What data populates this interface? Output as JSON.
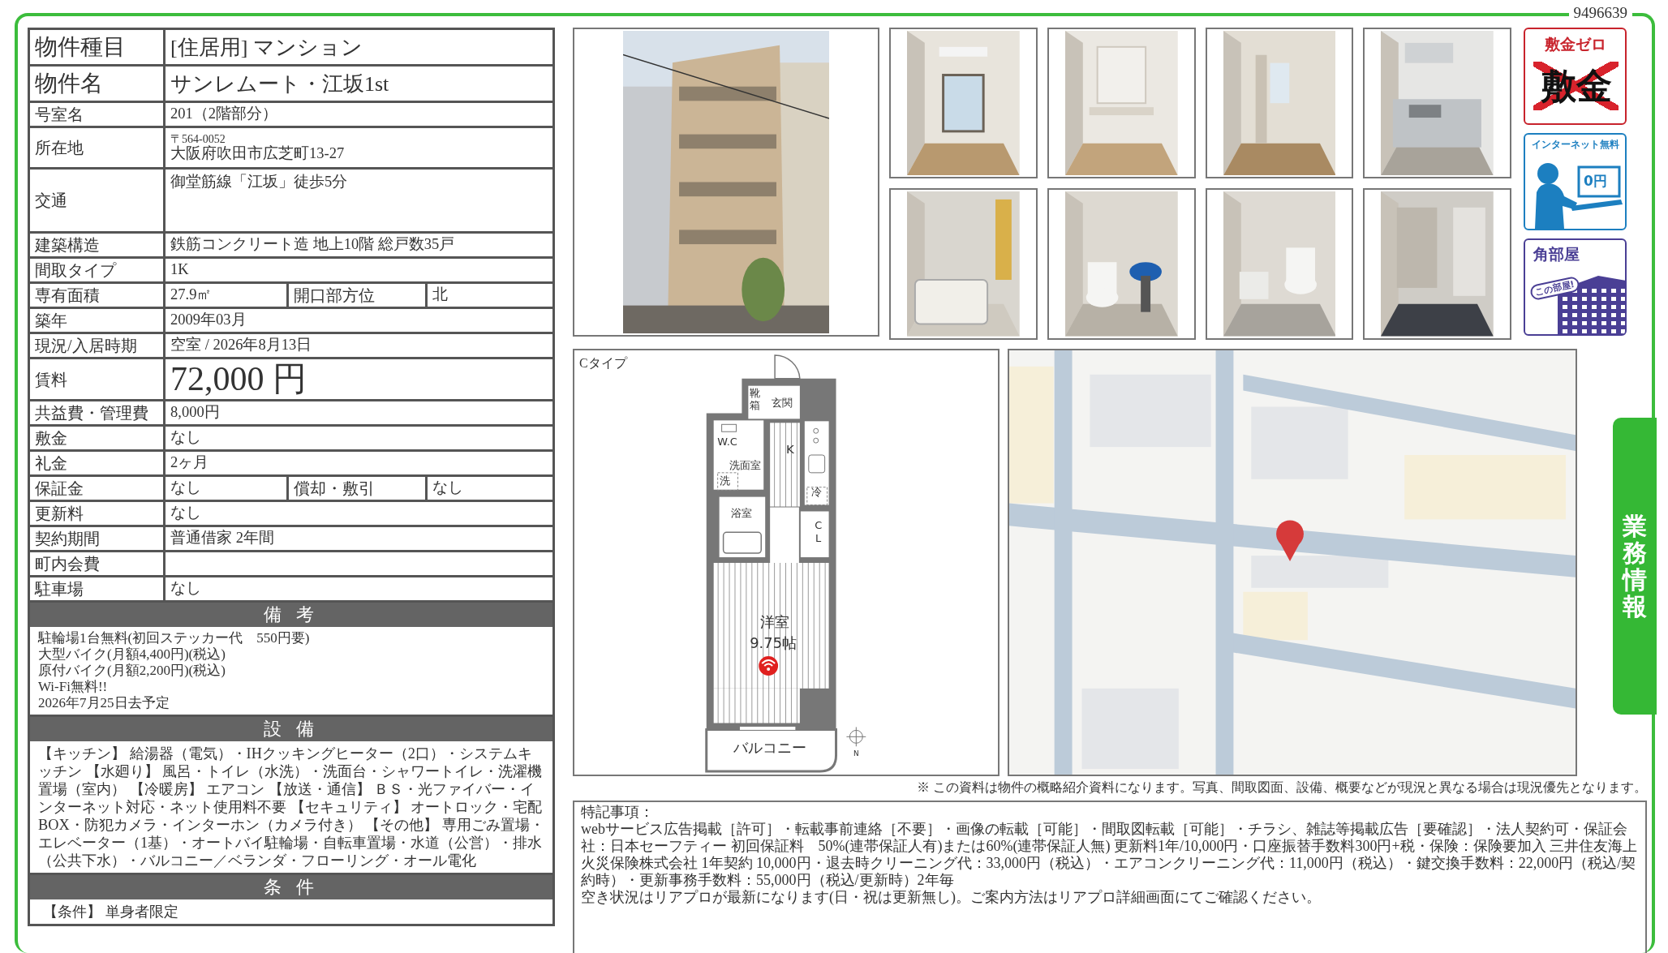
{
  "document_id": "9496639",
  "side_tab": "業務情報",
  "property_table": [
    {
      "kind": "title",
      "label": "物件種目",
      "value": "[住居用] マンション"
    },
    {
      "kind": "title",
      "label": "物件名",
      "value": "サンレムート・江坂1st"
    },
    {
      "kind": "plain",
      "label": "号室名",
      "value": "201（2階部分）"
    },
    {
      "kind": "address",
      "label": "所在地",
      "postal": "〒564-0052",
      "value": "大阪府吹田市広芝町13-27"
    },
    {
      "kind": "tall",
      "label": "交通",
      "value": "御堂筋線「江坂」徒歩5分"
    },
    {
      "kind": "plain",
      "label": "建築構造",
      "value": "鉄筋コンクリート造 地上10階 総戸数35戸"
    },
    {
      "kind": "plain",
      "label": "間取タイプ",
      "value": "1K"
    },
    {
      "kind": "split",
      "label": "専有面積",
      "value": "27.9㎡",
      "label_2": "開口部方位",
      "value_2": "北"
    },
    {
      "kind": "plain",
      "label": "築年",
      "value": "2009年03月"
    },
    {
      "kind": "plain",
      "label": "現況/入居時期",
      "value": "空室 / 2026年8月13日"
    },
    {
      "kind": "rent",
      "label": "賃料",
      "value": "72,000 円"
    },
    {
      "kind": "plain",
      "label": "共益費・管理費",
      "value": "8,000円"
    },
    {
      "kind": "plain",
      "label": "敷金",
      "value": "なし"
    },
    {
      "kind": "plain",
      "label": "礼金",
      "value": "2ヶ月"
    },
    {
      "kind": "split",
      "label": "保証金",
      "value": "なし",
      "label_2": "償却・敷引",
      "value_2": "なし"
    },
    {
      "kind": "plain",
      "label": "更新料",
      "value": "なし"
    },
    {
      "kind": "plain",
      "label": "契約期間",
      "value": "普通借家 2年間"
    },
    {
      "kind": "plain",
      "label": "町内会費"
    },
    {
      "kind": "plain",
      "label": "駐車場",
      "value": "なし"
    }
  ],
  "remarks": {
    "heading": "備 考",
    "lines": [
      "駐輪場1台無料(初回ステッカー代　550円要)",
      "大型バイク(月額4,400円)(税込)",
      "原付バイク(月額2,200円)(税込)",
      "Wi-Fi無料!!",
      "2026年7月25日去予定"
    ]
  },
  "equipment": {
    "heading": "設 備",
    "text": "【キッチン】 給湯器（電気）・IHクッキングヒーター（2口）・システムキッチン 【水廻り】 風呂・トイレ（水洗）・洗面台・シャワートイレ・洗濯機置場（室内） 【冷暖房】 エアコン 【放送・通信】 ＢＳ・光ファイバー・インターネット対応・ネット使用料不要 【セキュリティ】 オートロック・宅配BOX・防犯カメラ・インターホン（カメラ付き） 【その他】 専用ごみ置場・エレベーター（1基）・オートバイ駐輪場・自転車置場・水道（公営）・排水（公共下水）・バルコニー／ベランダ・フローリング・オール電化"
  },
  "conditions": {
    "heading": "条 件",
    "text": "【条件】 単身者限定"
  },
  "badges": [
    {
      "kind": "deposit_zero",
      "title": "敷金ゼロ",
      "text": "敷金"
    },
    {
      "kind": "internet_free",
      "title": "インターネット無料",
      "text": "0円"
    },
    {
      "kind": "corner_room",
      "title": "角部屋",
      "text": "この部屋!"
    }
  ],
  "floor_plan": {
    "caption": "Cタイプ",
    "labels": [
      {
        "kind": "vertical",
        "text": "靴箱"
      },
      {
        "kind": "small",
        "text": "玄関"
      },
      {
        "kind": "small",
        "text": "W.C"
      },
      {
        "kind": "small",
        "text": "洗面室"
      },
      {
        "kind": "small",
        "text": "洗"
      },
      {
        "kind": "medium",
        "text": "K"
      },
      {
        "kind": "small",
        "text": "冷"
      },
      {
        "kind": "small",
        "text": "浴室"
      },
      {
        "kind": "vertical",
        "text": "CL"
      },
      {
        "kind": "large",
        "text": "洋室"
      },
      {
        "kind": "large",
        "text": "9.75帖"
      },
      {
        "kind": "large",
        "text": "バルコニー"
      },
      {
        "kind": "tiny",
        "text": "N"
      }
    ]
  },
  "disclaimer": "※ この資料は物件の概略紹介資料になります。写真、間取図面、設備、概要などが現況と異なる場合は現況優先となります。",
  "special_notes": {
    "heading": "特記事項：",
    "paragraphs": [
      "webサービス広告掲載［許可］・転載事前連絡［不要］・画像の転載［可能］・間取図転載［可能］・チラシ、雑誌等掲載広告［要確認］・法人契約可・保証会社：日本セーフティー 初回保証料　50%(連帯保証人有)または60%(連帯保証人無) 更新料1年/10,000円・口座振替手数料300円+税・保険：保険要加入 三井住友海上火災保険株式会社 1年契約 10,000円・退去時クリーニング代：33,000円（税込）・エアコンクリーニング代：11,000円（税込）・鍵交換手数料：22,000円（税込/契約時）・更新事務手数料：55,000円（税込/更新時）2年毎",
      "空き状況はリアプロが最新になります(日・祝は更新無し)。ご案内方法はリアプロ詳細画面にてご確認ください。"
    ]
  }
}
